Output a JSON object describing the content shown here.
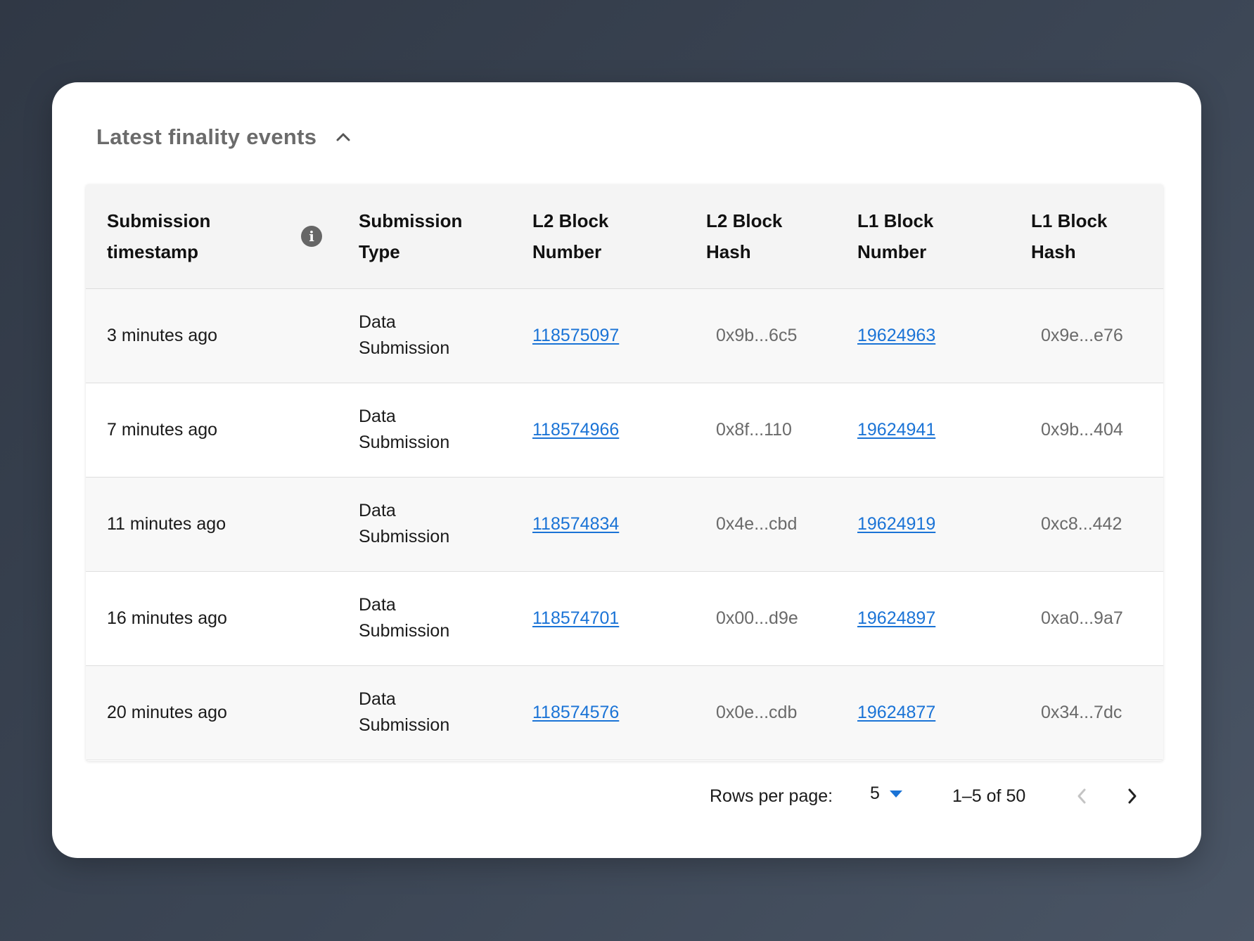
{
  "section": {
    "title": "Latest finality events",
    "collapse_icon": "chevron-up-icon"
  },
  "table": {
    "headers": [
      {
        "label": "Submission timestamp",
        "has_info_icon": true
      },
      {
        "label": "Submission Type"
      },
      {
        "label": "L2 Block Number"
      },
      {
        "label": "L2 Block Hash"
      },
      {
        "label": "L1 Block Number"
      },
      {
        "label": "L1 Block Hash"
      }
    ],
    "rows": [
      {
        "timestamp": "3 minutes ago",
        "type": "Data Submission",
        "l2_block_number": "118575097",
        "l2_block_hash": "0x9b...6c5",
        "l1_block_number": "19624963",
        "l1_block_hash": "0x9e...e76"
      },
      {
        "timestamp": "7 minutes ago",
        "type": "Data Submission",
        "l2_block_number": "118574966",
        "l2_block_hash": "0x8f...110",
        "l1_block_number": "19624941",
        "l1_block_hash": "0x9b...404"
      },
      {
        "timestamp": "11 minutes ago",
        "type": "Data Submission",
        "l2_block_number": "118574834",
        "l2_block_hash": "0x4e...cbd",
        "l1_block_number": "19624919",
        "l1_block_hash": "0xc8...442"
      },
      {
        "timestamp": "16 minutes ago",
        "type": "Data Submission",
        "l2_block_number": "118574701",
        "l2_block_hash": "0x00...d9e",
        "l1_block_number": "19624897",
        "l1_block_hash": "0xa0...9a7"
      },
      {
        "timestamp": "20 minutes ago",
        "type": "Data Submission",
        "l2_block_number": "118574576",
        "l2_block_hash": "0x0e...cdb",
        "l1_block_number": "19624877",
        "l1_block_hash": "0x34...7dc"
      }
    ]
  },
  "pagination": {
    "rows_per_page_label": "Rows per page:",
    "rows_per_page_value": "5",
    "range_text": "1–5 of 50",
    "prev_enabled": false,
    "next_enabled": true
  },
  "colors": {
    "link": "#1a73d6",
    "background": "#3c4655",
    "card": "#ffffff",
    "header_row": "#f4f4f4"
  }
}
